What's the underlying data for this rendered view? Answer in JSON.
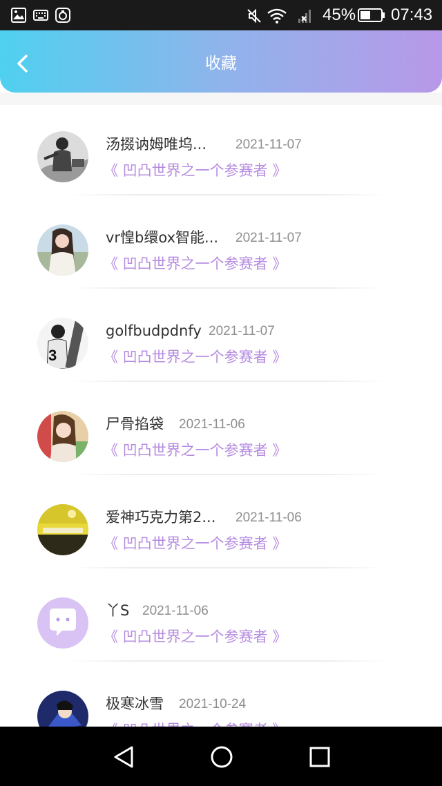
{
  "status_bar": {
    "battery_percent": "45%",
    "time": "07:43",
    "left_icons": [
      "image-icon",
      "keyboard-icon",
      "app-notification-icon"
    ],
    "right_icons": [
      "mute-icon",
      "wifi-icon",
      "no-signal-icon",
      "battery-icon"
    ]
  },
  "header": {
    "title": "收藏",
    "back_icon": "chevron-left-icon",
    "gradient_start": "#4fd0ef",
    "gradient_end": "#b898e8"
  },
  "favorites": [
    {
      "name": "汤掇讷姆唯坞...",
      "date": "2021-11-07",
      "work": "《 凹凸世界之一个参赛者 》"
    },
    {
      "name": "vr惶b缳ox智能...",
      "date": "2021-11-07",
      "work": "《 凹凸世界之一个参赛者 》"
    },
    {
      "name": "golfbudpdnfy",
      "date": "2021-11-07",
      "work": "《 凹凸世界之一个参赛者 》"
    },
    {
      "name": "尸骨掐袋",
      "date": "2021-11-06",
      "work": "《 凹凸世界之一个参赛者 》"
    },
    {
      "name": "爱神巧克力第2...",
      "date": "2021-11-06",
      "work": "《 凹凸世界之一个参赛者 》"
    },
    {
      "name": "丫S",
      "date": "2021-11-06",
      "work": "《 凹凸世界之一个参赛者 》"
    },
    {
      "name": "极寒冰雪",
      "date": "2021-10-24",
      "work": "《 凹凸世界之一个参赛者 》"
    }
  ],
  "colors": {
    "work_title": "#b58be0",
    "date": "#8e8e8e",
    "name": "#333333"
  },
  "system_nav": {
    "buttons": [
      "back-triangle-icon",
      "home-circle-icon",
      "recents-square-icon"
    ]
  }
}
